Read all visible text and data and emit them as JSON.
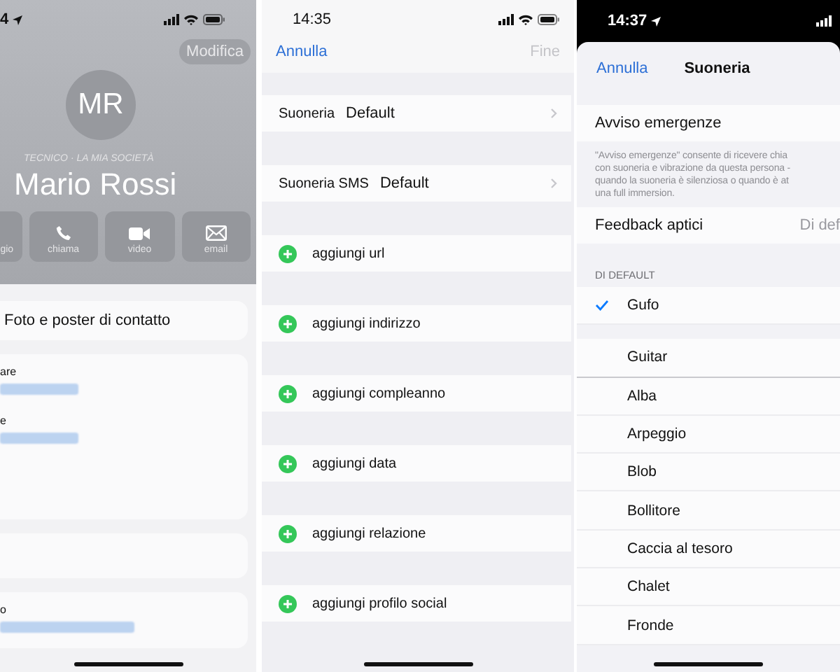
{
  "contact_screen": {
    "status_time": "4",
    "edit_button": "Modifica",
    "avatar_initials": "MR",
    "subtitle": "TECNICO · LA MIA SOCIETÀ",
    "name": "Mario Rossi",
    "actions": [
      {
        "label": "gio"
      },
      {
        "label": "chiama",
        "kind": "phone"
      },
      {
        "label": "video",
        "kind": "video"
      },
      {
        "label": "email",
        "kind": "mail"
      }
    ],
    "poster_row": "Foto e poster di contatto",
    "fields": [
      {
        "label": "are"
      },
      {
        "label": "e"
      }
    ],
    "last_field_label": "o"
  },
  "edit_screen": {
    "status_time": "14:35",
    "cancel": "Annulla",
    "done": {
      "label": "Fine",
      "disabled": true
    },
    "ringtone_rows": [
      {
        "label": "Suoneria",
        "value": "Default"
      },
      {
        "label": "Suoneria SMS",
        "value": "Default"
      }
    ],
    "add_rows": [
      "aggiungi url",
      "aggiungi indirizzo",
      "aggiungi compleanno",
      "aggiungi data",
      "aggiungi relazione",
      "aggiungi profilo social"
    ]
  },
  "ringtone_screen": {
    "status_time": "14:37",
    "cancel": "Annulla",
    "title": "Suoneria",
    "emergency_label": "Avviso emergenze",
    "emergency_note_lines": [
      "\"Avviso emergenze\" consente di ricevere chia",
      "con suoneria e vibrazione da questa persona -",
      "quando la suoneria è silenziosa o quando è at",
      "una full immersion."
    ],
    "haptics": {
      "label": "Feedback aptici",
      "value": "Di def"
    },
    "section_header": "DI DEFAULT",
    "default_tones": [
      {
        "name": "Gufo",
        "selected": true
      }
    ],
    "tones": [
      {
        "name": "Guitar",
        "selected": false
      },
      {
        "name": "Alba",
        "selected": false
      },
      {
        "name": "Arpeggio",
        "selected": false
      },
      {
        "name": "Blob",
        "selected": false
      },
      {
        "name": "Bollitore",
        "selected": false
      },
      {
        "name": "Caccia al tesoro",
        "selected": false
      },
      {
        "name": "Chalet",
        "selected": false
      },
      {
        "name": "Fronde",
        "selected": false
      }
    ]
  }
}
